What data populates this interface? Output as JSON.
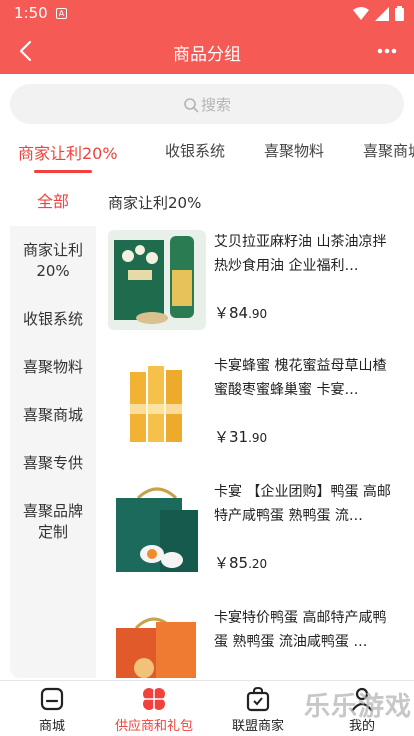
{
  "status_bar": {
    "time": "1:50",
    "notification_letter": "A"
  },
  "nav": {
    "title": "商品分组"
  },
  "search": {
    "placeholder": "搜索"
  },
  "tabs": [
    {
      "label": "商家让利20%",
      "active": true
    },
    {
      "label": "收银系统"
    },
    {
      "label": "喜聚物料"
    },
    {
      "label": "喜聚商城"
    }
  ],
  "sidebar": {
    "items": [
      {
        "label": "全部",
        "active": true
      },
      {
        "label": "商家让利\n20%"
      },
      {
        "label": "收银系统"
      },
      {
        "label": "喜聚物料"
      },
      {
        "label": "喜聚商城"
      },
      {
        "label": "喜聚专供"
      },
      {
        "label": "喜聚品牌\n定制"
      }
    ]
  },
  "section": {
    "title": "商家让利20%"
  },
  "products": [
    {
      "name": "艾贝拉亚麻籽油 山茶油凉拌热炒食用油 企业福利…",
      "price_symbol": "￥",
      "price_int": "84",
      "price_dec": ".90"
    },
    {
      "name": "卡宴蜂蜜 槐花蜜益母草山楂蜜酸枣蜜蜂巢蜜 卡宴…",
      "price_symbol": "￥",
      "price_int": "31",
      "price_dec": ".90"
    },
    {
      "name": "卡宴 【企业团购】鸭蛋 高邮特产咸鸭蛋 熟鸭蛋 流…",
      "price_symbol": "￥",
      "price_int": "85",
      "price_dec": ".20"
    },
    {
      "name": "卡宴特价鸭蛋 高邮特产咸鸭蛋 熟鸭蛋 流油咸鸭蛋 …",
      "price_symbol": "",
      "price_int": "",
      "price_dec": ""
    }
  ],
  "bottom_nav": [
    {
      "label": "商城",
      "icon": "store-icon"
    },
    {
      "label": "供应商和礼包",
      "icon": "gift-icon",
      "active": true
    },
    {
      "label": "联盟商家",
      "icon": "bag-icon"
    },
    {
      "label": "我的",
      "icon": "user-icon"
    }
  ],
  "watermark": {
    "text": "乐乐游戏"
  },
  "colors": {
    "accent": "#f55a55",
    "active_text": "#f0413c"
  }
}
